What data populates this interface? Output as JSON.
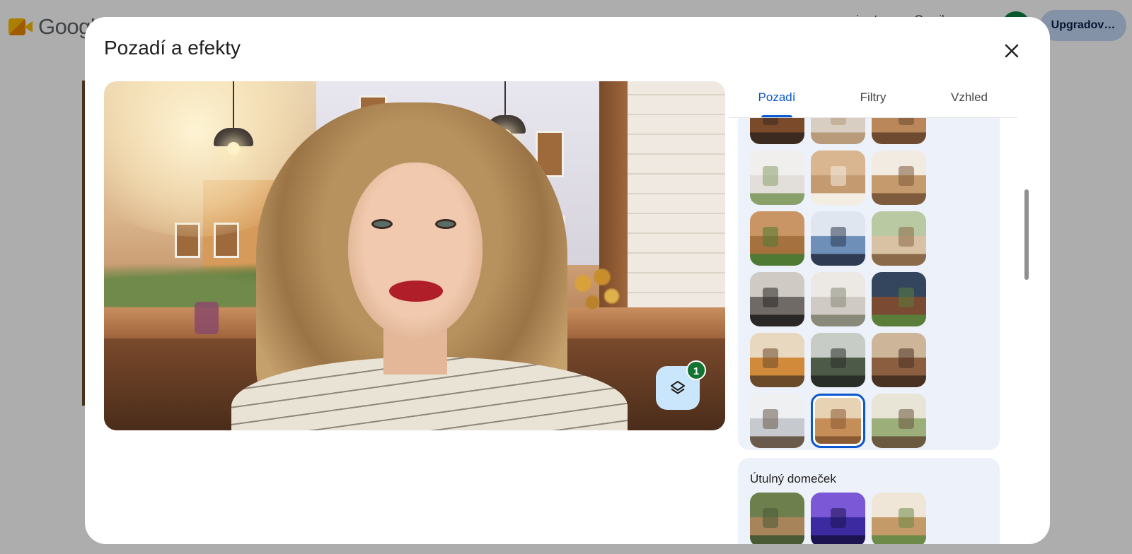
{
  "app": {
    "logo_text": "Google",
    "header_email": "j… t… c… G… il",
    "upgrade_label": "Upgradov…"
  },
  "dialog": {
    "title": "Pozadí a efekty",
    "close_icon": "close-icon",
    "layers_icon": "layers-icon",
    "effects_count": "1"
  },
  "tabs": [
    {
      "label": "Pozadí",
      "active": true
    },
    {
      "label": "Filtry",
      "active": false
    },
    {
      "label": "Vzhled",
      "active": false
    }
  ],
  "sections": [
    {
      "label": "",
      "thumbnails": [
        "kitchen-table",
        "white-cabinet",
        "bookshelf-room",
        "white-wall-plant",
        "wood-wall-lamp",
        "bookshelves",
        "wood-panel-plant",
        "glass-office",
        "green-wall-sofa",
        "library-chair",
        "bright-lounge",
        "brick-plant",
        "orange-living-room",
        "glass-courtyard",
        "cafe-counter",
        "snowy-window-desk",
        "cafe-window",
        "green-dining-room"
      ],
      "selected_index": 16
    },
    {
      "label": "Útulný domeček",
      "thumbnails": [
        "garden-patio",
        "neon-studio",
        "plant-shelves"
      ]
    }
  ],
  "colors": {
    "accent": "#0b57d0",
    "badge": "#137333",
    "panel_bg": "#edf1f9",
    "layers_button_bg": "#c9e6fc"
  }
}
